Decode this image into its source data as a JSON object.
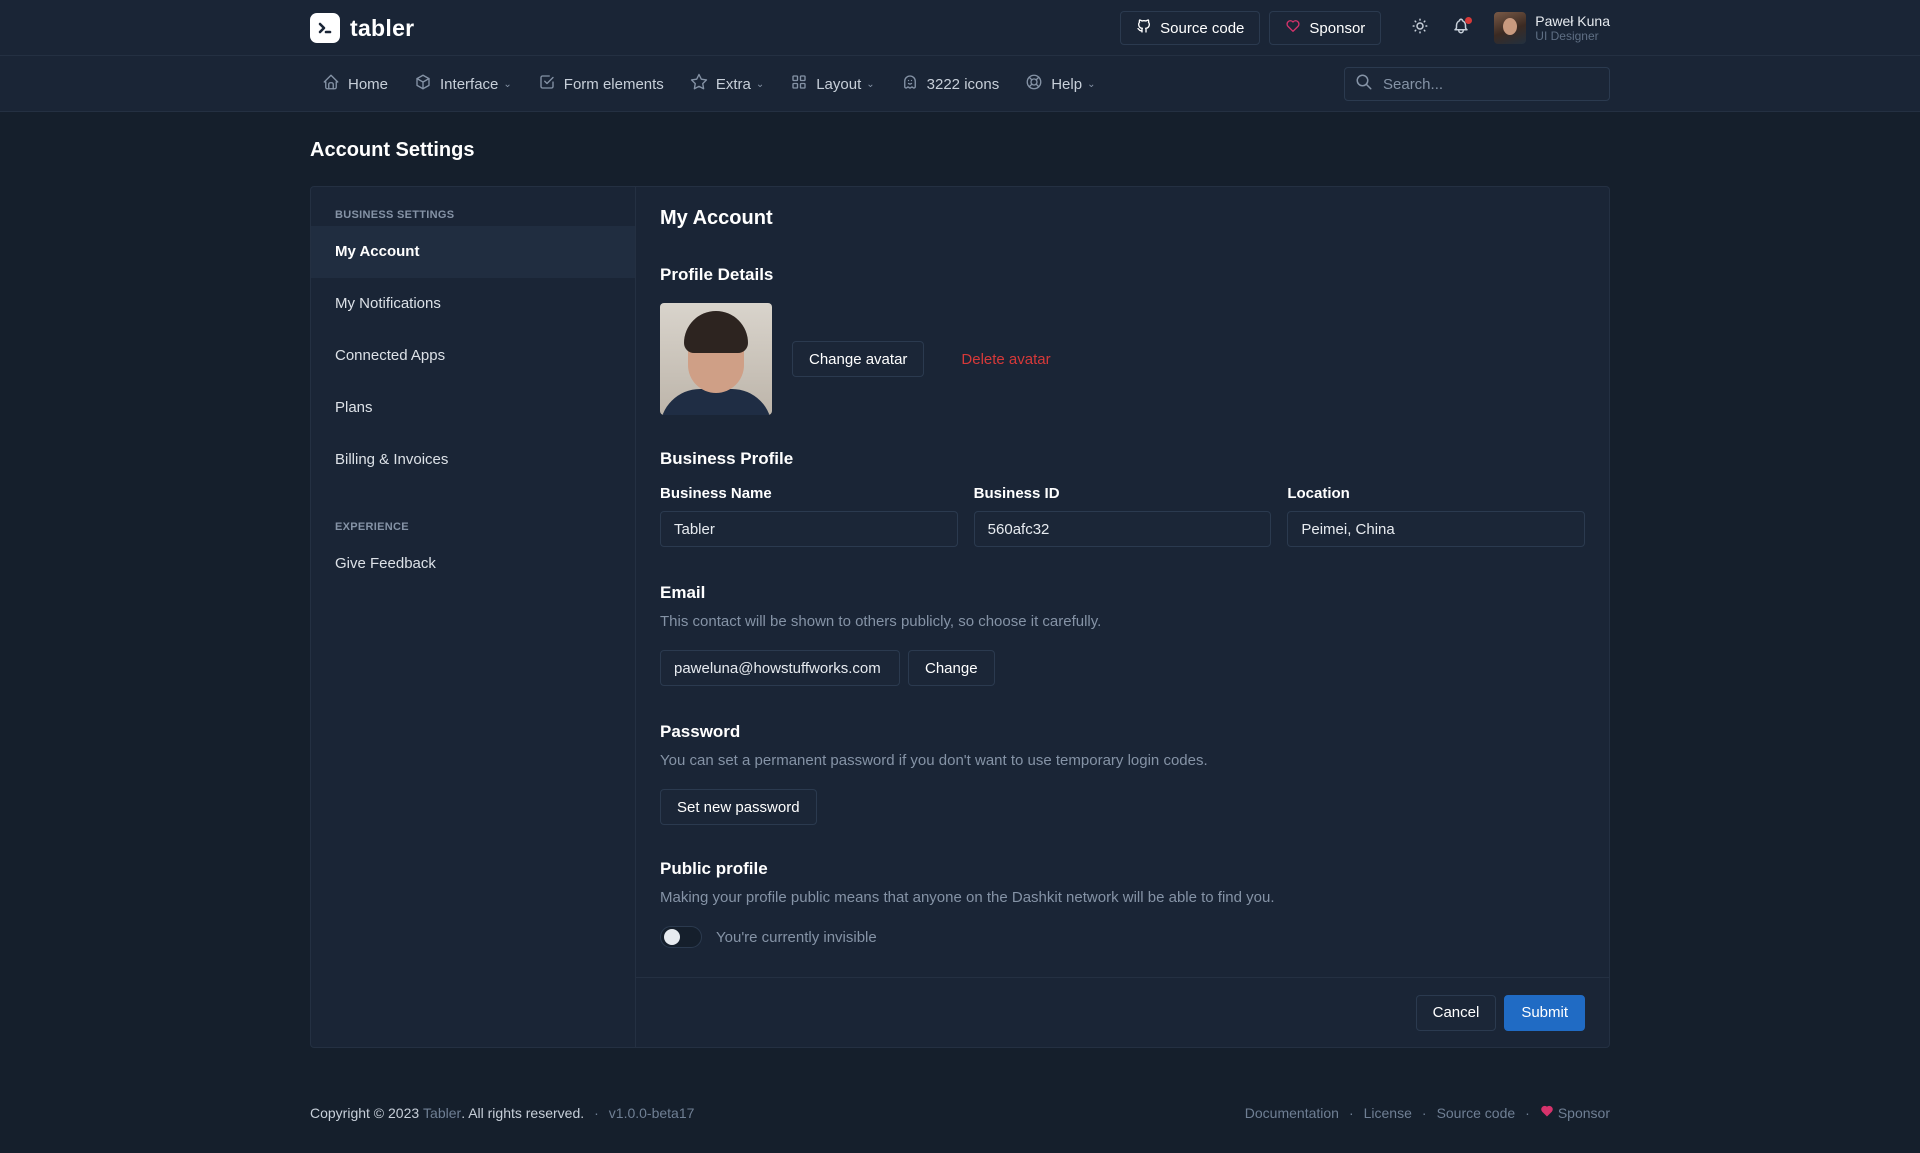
{
  "header": {
    "brand": "tabler",
    "source_code_label": "Source code",
    "sponsor_label": "Sponsor",
    "user_name": "Paweł Kuna",
    "user_role": "UI Designer"
  },
  "nav": {
    "items": [
      {
        "label": "Home",
        "icon": "home-icon"
      },
      {
        "label": "Interface",
        "icon": "package-icon",
        "dropdown": true
      },
      {
        "label": "Form elements",
        "icon": "checkbox-icon"
      },
      {
        "label": "Extra",
        "icon": "star-icon",
        "dropdown": true
      },
      {
        "label": "Layout",
        "icon": "layout-grid-icon",
        "dropdown": true
      },
      {
        "label": "3222 icons",
        "icon": "ghost-icon"
      },
      {
        "label": "Help",
        "icon": "lifebuoy-icon",
        "dropdown": true
      }
    ],
    "search_placeholder": "Search..."
  },
  "page": {
    "title": "Account Settings"
  },
  "sidebar": {
    "business_heading": "Business settings",
    "items": [
      {
        "label": "My Account",
        "active": true
      },
      {
        "label": "My Notifications"
      },
      {
        "label": "Connected Apps"
      },
      {
        "label": "Plans"
      },
      {
        "label": "Billing & Invoices"
      }
    ],
    "experience_heading": "Experience",
    "experience_items": [
      {
        "label": "Give Feedback"
      }
    ]
  },
  "account": {
    "title": "My Account",
    "profile_details": "Profile Details",
    "change_avatar": "Change avatar",
    "delete_avatar": "Delete avatar",
    "business_profile": "Business Profile",
    "business_name_label": "Business Name",
    "business_name_value": "Tabler",
    "business_id_label": "Business ID",
    "business_id_value": "560afc32",
    "location_label": "Location",
    "location_value": "Peimei, China",
    "email_title": "Email",
    "email_desc": "This contact will be shown to others publicly, so choose it carefully.",
    "email_value": "paweluna@howstuffworks.com",
    "email_change": "Change",
    "password_title": "Password",
    "password_desc": "You can set a permanent password if you don't want to use temporary login codes.",
    "set_password": "Set new password",
    "public_title": "Public profile",
    "public_desc": "Making your profile public means that anyone on the Dashkit network will be able to find you.",
    "toggle_label": "You're currently invisible",
    "cancel": "Cancel",
    "submit": "Submit"
  },
  "footer": {
    "copyright_prefix": "Copyright © 2023",
    "brand_link": "Tabler",
    "copyright_suffix": ". All rights reserved.",
    "version": "v1.0.0-beta17",
    "links": [
      "Documentation",
      "License",
      "Source code",
      "Sponsor"
    ]
  },
  "colors": {
    "background": "#151f2c",
    "surface": "#1a2536",
    "primary": "#206bc4",
    "danger": "#d63939",
    "sponsor_heart": "#d6336c"
  }
}
